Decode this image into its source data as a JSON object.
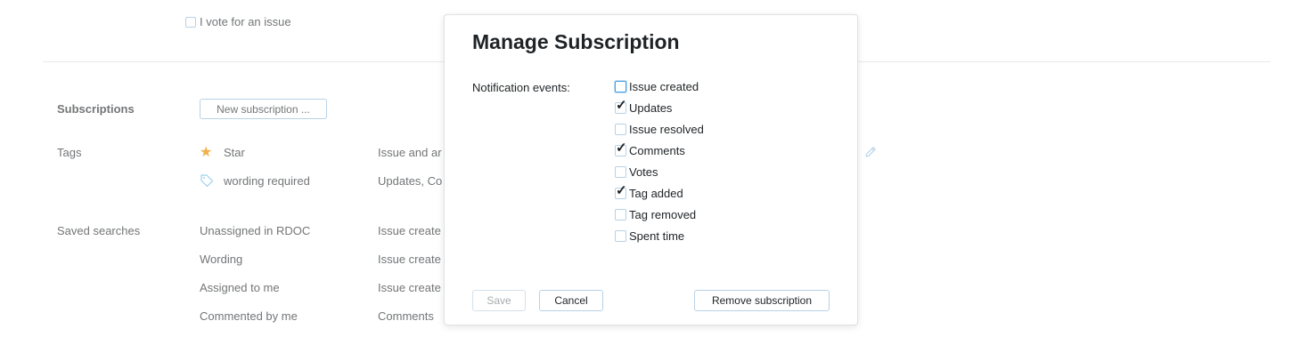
{
  "voting": {
    "label": "I vote for an issue",
    "checked": false
  },
  "subscriptions": {
    "section_label": "Subscriptions",
    "new_button": "New subscription ..."
  },
  "tags": {
    "section_label": "Tags",
    "items": [
      {
        "icon": "star-icon",
        "name": "Star",
        "events": "Issue and ar"
      },
      {
        "icon": "tag-icon",
        "name": "wording required",
        "events": "Updates, Co"
      }
    ]
  },
  "saved_searches": {
    "section_label": "Saved searches",
    "items": [
      {
        "name": "Unassigned in RDOC",
        "events": "Issue create"
      },
      {
        "name": "Wording",
        "events": "Issue create"
      },
      {
        "name": "Assigned to me",
        "events": "Issue create"
      },
      {
        "name": "Commented by me",
        "events": "Comments"
      }
    ]
  },
  "modal": {
    "title": "Manage Subscription",
    "notification_label": "Notification events:",
    "events": [
      {
        "label": "Issue created",
        "checked": false,
        "focused": true
      },
      {
        "label": "Updates",
        "checked": true
      },
      {
        "label": "Issue resolved",
        "checked": false
      },
      {
        "label": "Comments",
        "checked": true
      },
      {
        "label": "Votes",
        "checked": false
      },
      {
        "label": "Tag added",
        "checked": true
      },
      {
        "label": "Tag removed",
        "checked": false
      },
      {
        "label": "Spent time",
        "checked": false
      }
    ],
    "save_label": "Save",
    "cancel_label": "Cancel",
    "remove_label": "Remove subscription"
  },
  "colors": {
    "accent_border": "#b8d1e5",
    "star": "#f0b04a",
    "tag": "#9bd0ee"
  }
}
